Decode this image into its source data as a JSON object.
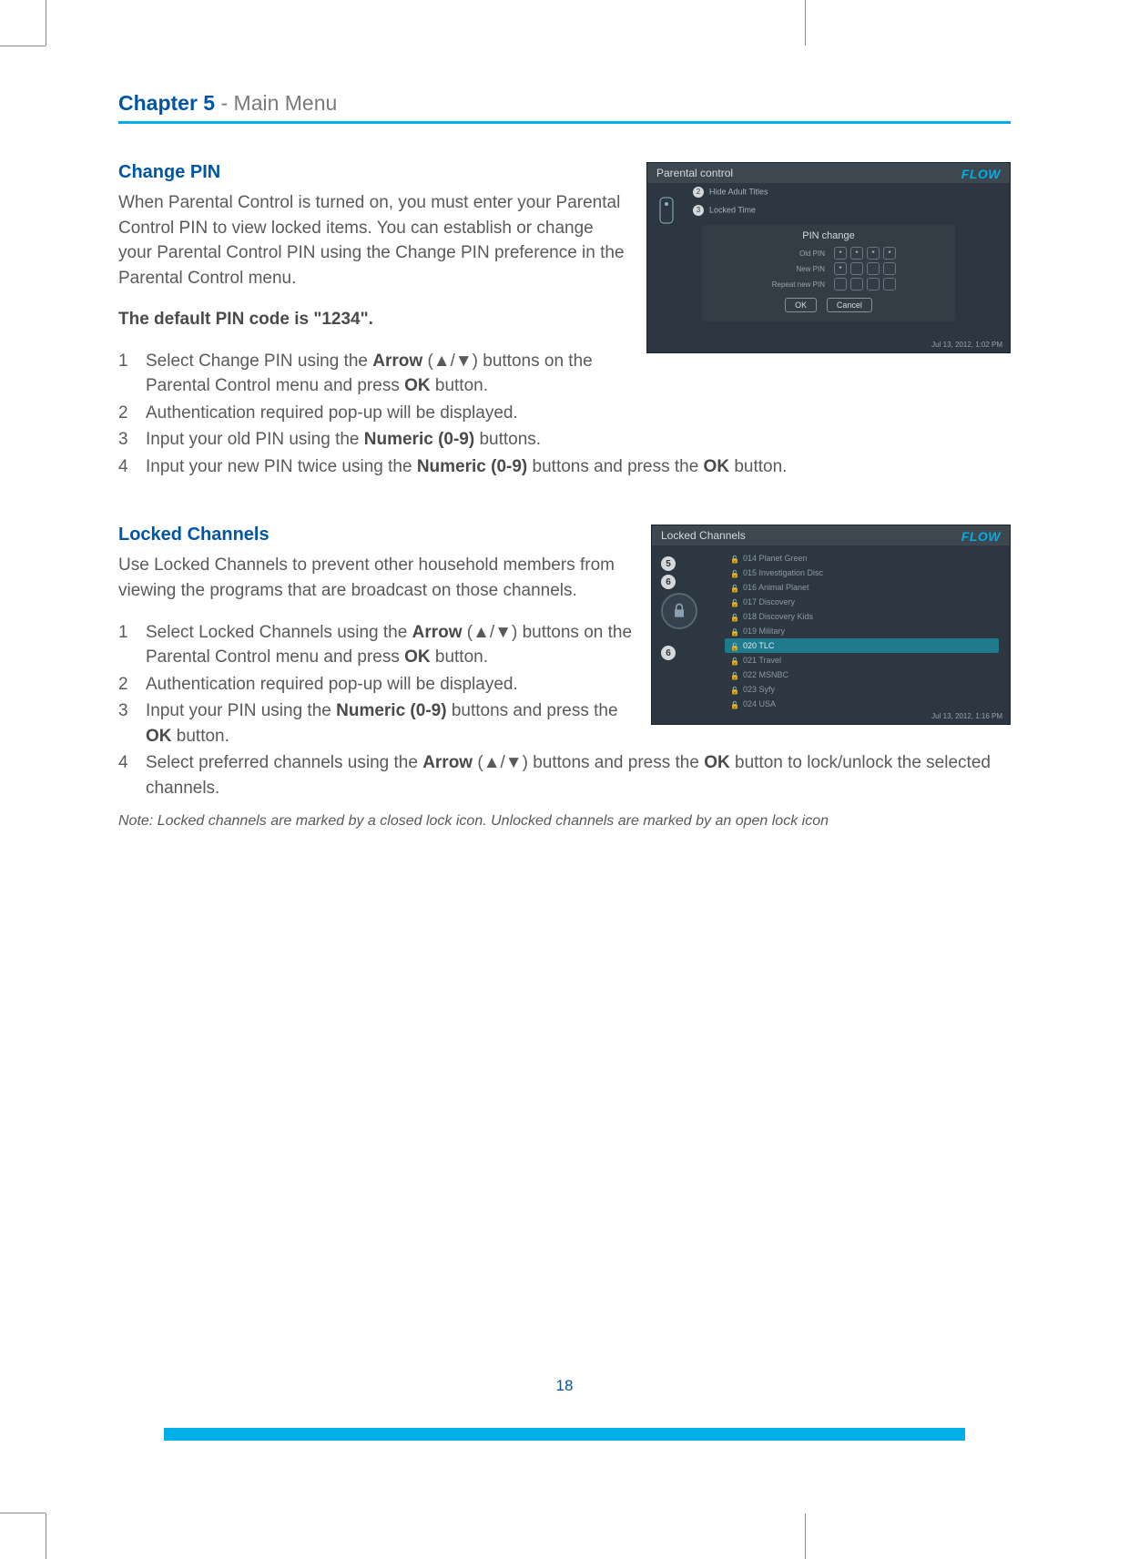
{
  "chapter": {
    "bold": "Chapter 5",
    "rest": " - Main Menu"
  },
  "page_number": "18",
  "section1": {
    "title": "Change PIN",
    "intro": "When Parental Control is turned on, you must enter your Parental Control PIN to view locked items. You can establish or change your Parental Control PIN using the Change PIN preference in the Parental Control menu.",
    "default_pin": "The default PIN code is \"1234\".",
    "steps": {
      "s1a": "Select Change PIN using the ",
      "s1b": "Arrow",
      "s1c": " (▲/▼) buttons on the Parental Control menu and press ",
      "s1d": "OK",
      "s1e": " button.",
      "s2": "Authentication required pop-up will be displayed.",
      "s3a": "Input your old PIN using the ",
      "s3b": "Numeric (0-9)",
      "s3c": " buttons.",
      "s4a": "Input your new PIN twice using the ",
      "s4b": "Numeric (0-9)",
      "s4c": " buttons and press the ",
      "s4d": "OK",
      "s4e": " button."
    },
    "screenshot": {
      "title": "Parental control",
      "brand": "FLOW",
      "menu1_num": "2",
      "menu1": "Hide Adult Titles",
      "menu2_num": "3",
      "menu2": "Locked Time",
      "panel_title": "PIN change",
      "row1": "Old PIN",
      "row2": "New PIN",
      "row3": "Repeat new PIN",
      "btn_ok": "OK",
      "btn_cancel": "Cancel",
      "time": "Jul 13, 2012,  1:02 PM"
    }
  },
  "section2": {
    "title": "Locked Channels",
    "intro": "Use Locked Channels to prevent other household members from viewing the programs that are broadcast on those channels.",
    "steps": {
      "s1a": "Select Locked Channels using the ",
      "s1b": "Arrow",
      "s1c": " (▲/▼) buttons on the Parental Control menu and press ",
      "s1d": "OK",
      "s1e": " button.",
      "s2": "Authentication required pop-up will be displayed.",
      "s3a": "Input your PIN using the ",
      "s3b": "Numeric (0-9)",
      "s3c": " buttons and press the ",
      "s3d": "OK",
      "s3e": " button.",
      "s4a": "Select preferred channels using the ",
      "s4b": "Arrow",
      "s4c": " (▲/▼) buttons and press the ",
      "s4d": "OK",
      "s4e": " button to lock/unlock the selected channels."
    },
    "note": "Note: Locked channels are marked by a closed lock icon. Unlocked channels are marked by an open lock icon",
    "screenshot": {
      "title": "Locked Channels",
      "brand": "FLOW",
      "knob1": "5",
      "knob2": "6",
      "knob3": "6",
      "channels": [
        {
          "txt": "014 Planet Green",
          "lock": "open"
        },
        {
          "txt": "015 Investigation Disc",
          "lock": "open"
        },
        {
          "txt": "016 Animal Planet",
          "lock": "open"
        },
        {
          "txt": "017 Discovery",
          "lock": "open"
        },
        {
          "txt": "018 Discovery Kids",
          "lock": "open"
        },
        {
          "txt": "019 Military",
          "lock": "closed"
        },
        {
          "txt": "020 TLC",
          "lock": "open",
          "sel": true
        },
        {
          "txt": "021 Travel",
          "lock": "open"
        },
        {
          "txt": "022 MSNBC",
          "lock": "open"
        },
        {
          "txt": "023 Syfy",
          "lock": "open"
        },
        {
          "txt": "024 USA",
          "lock": "open"
        }
      ],
      "time": "Jul 13, 2012,  1:16 PM"
    }
  }
}
